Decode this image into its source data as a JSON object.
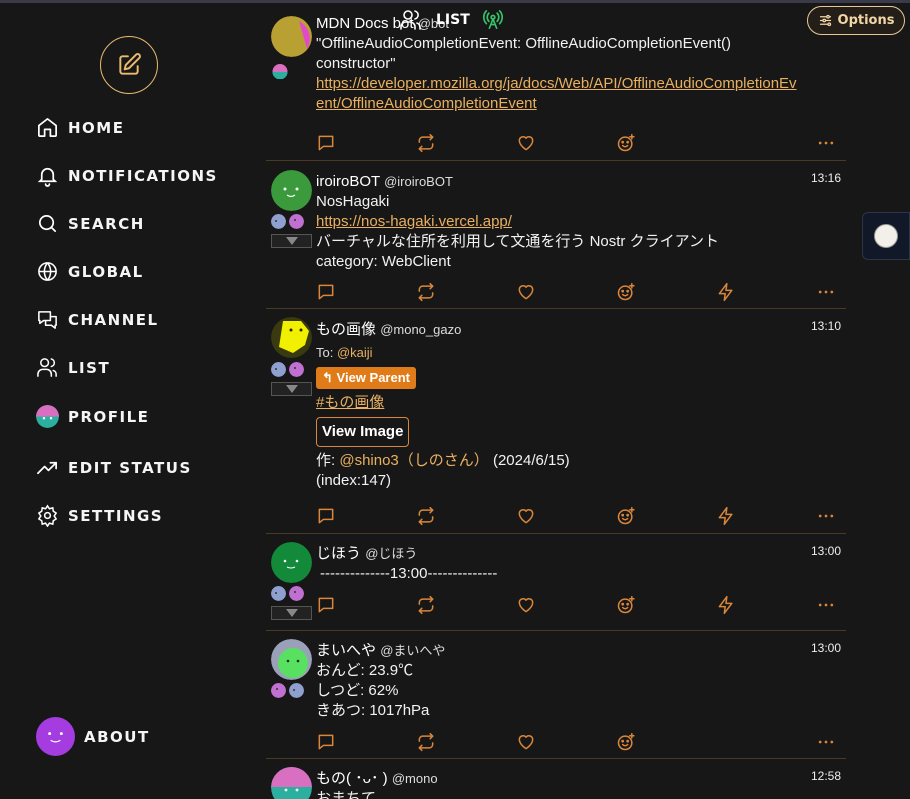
{
  "header": {
    "title": "LIST",
    "options_label": "Options"
  },
  "sidebar": {
    "items": [
      {
        "label": "HOME"
      },
      {
        "label": "NOTIFICATIONS"
      },
      {
        "label": "SEARCH"
      },
      {
        "label": "GLOBAL"
      },
      {
        "label": "CHANNEL"
      },
      {
        "label": "LIST"
      },
      {
        "label": "PROFILE"
      },
      {
        "label": "EDIT STATUS"
      },
      {
        "label": "SETTINGS"
      }
    ],
    "about": "ABOUT"
  },
  "posts": [
    {
      "name": "MDN Docs bot",
      "handle": "@bot",
      "time": "",
      "lines": [
        "\"OfflineAudioCompletionEvent: OfflineAudioCompletionEvent()",
        "constructor\""
      ],
      "link1": "https://developer.mozilla.org/ja/docs/Web/API/OfflineAudioCompletionEv",
      "link2": "ent/OfflineAudioCompletionEvent"
    },
    {
      "name": "iroiroBOT",
      "handle": "@iroiroBOT",
      "time": "13:16",
      "line1": "NosHagaki",
      "link": "https://nos-hagaki.vercel.app/",
      "line2": "バーチャルな住所を利用して文通を行う Nostr クライアント",
      "line3": "category: WebClient"
    },
    {
      "name": "もの画像",
      "handle": "@mono_gazo",
      "time": "13:10",
      "to_label": "To:",
      "to_handle": "@kaiji",
      "view_parent": "View Parent",
      "hashtag": "#もの画像",
      "view_image": "View Image",
      "credit_prefix": "作:",
      "credit_handle": "@shino3（しのさん）",
      "credit_date": "(2024/6/15)",
      "index": "(index:147)"
    },
    {
      "name": "じほう",
      "handle": "@じほう",
      "time": "13:00",
      "line1": "--------------13:00--------------"
    },
    {
      "name": "まいへや",
      "handle": "@まいへや",
      "time": "13:00",
      "line1": "おんど: 23.9℃",
      "line2": "しつど: 62%",
      "line3": "きあつ: 1017hPa"
    },
    {
      "name": "もの( ･ᴗ･ )",
      "handle": "@mono",
      "time": "12:58",
      "line1": "おまちて"
    }
  ],
  "colors": {
    "accent": "#e8b060",
    "action": "#d9873a",
    "bg": "#181717"
  }
}
